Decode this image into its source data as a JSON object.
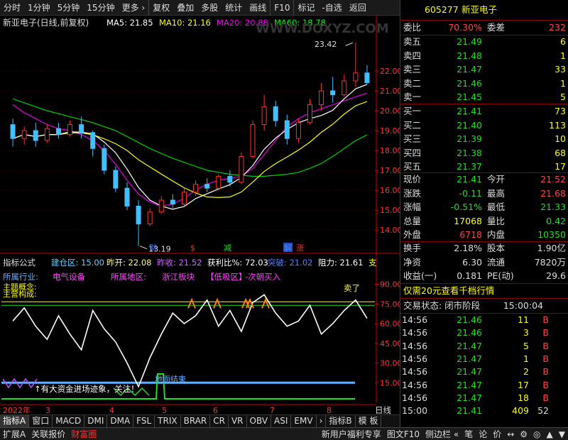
{
  "toolbar": [
    "分时",
    "1分钟",
    "5分钟",
    "15分钟",
    "更多 ›",
    "复权",
    "叠加",
    "多股",
    "统计",
    "画线",
    "F10",
    "标记",
    "-自选",
    "返回"
  ],
  "main": {
    "title": "新亚电子(日线,前复权)",
    "ma": [
      {
        "label": "MA5: 21.85",
        "color": "#ffffff"
      },
      {
        "label": "MA10: 21.16",
        "color": "#ffff00"
      },
      {
        "label": "MA20: 20.88",
        "color": "#ff00ff"
      },
      {
        "label": "MA60: 18.78",
        "color": "#00ff00"
      }
    ],
    "price_ticks": [
      "22.00",
      "21.00",
      "20.00",
      "19.00",
      "18.00",
      "17.00",
      "16.00",
      "15.00",
      "14.00"
    ],
    "high_label": "23.42",
    "low_label": "13.19",
    "markers": [
      "财",
      "$",
      "减",
      "解",
      "涨"
    ],
    "watermark": "WWW.DOXYZ.COM"
  },
  "indicator": {
    "header_label": "指标公式",
    "header_items": [
      {
        "text": "建仓区: 15.00",
        "color": "#5fd3ff"
      },
      {
        "text": "昨开: 22.08",
        "color": "#ffff66"
      },
      {
        "text": "昨收: 21.52",
        "color": "#d066ff"
      },
      {
        "text": "获利比%: 72.03",
        "color": "#ffffff"
      },
      {
        "text": "突破: 21.02",
        "color": "#5080ff"
      },
      {
        "text": "阻力: 21.61",
        "color": "#ffffff"
      },
      {
        "text": "支",
        "color": "#ffff00"
      }
    ],
    "info_row": [
      {
        "text": "所属行业:",
        "color": "#5fb0ff"
      },
      {
        "text": "电气设备",
        "color": "#ff44ff"
      },
      {
        "text": "所属地区:",
        "color": "#ff44ff"
      },
      {
        "text": "浙江板块",
        "color": "#ff44ff"
      },
      {
        "text": "【低吸区】",
        "color": "#ff44ff"
      },
      {
        "text": "-次朝买入",
        "color": "#ff44ff"
      }
    ],
    "left_labels": [
      "主题概念:",
      "主营构成:"
    ],
    "ticks": [
      "90.00",
      "75.00",
      "60.00",
      "45.00",
      "30.00",
      "15.00"
    ],
    "sell_label": "卖了",
    "note": "↑有大资金进场迹象，关注！",
    "end_label": "地面结束"
  },
  "xaxis": {
    "labels": [
      "2022年",
      "3",
      "4",
      "5",
      "6",
      "7",
      "8"
    ],
    "right": "日线"
  },
  "tabs": [
    "指标A",
    "窗口",
    "MACD",
    "DMI",
    "DMA",
    "FSL",
    "TRIX",
    "BRAR",
    "CR",
    "VR",
    "OBV",
    "ASI",
    "EMV",
    "›",
    "指标B",
    "模 板"
  ],
  "bottom": {
    "left": [
      "扩展A",
      "关联报价",
      "财富圈"
    ],
    "right": [
      "新用户福利专享",
      "图文F10",
      "侧边栏 «",
      "笔",
      "论",
      "价",
      "↔",
      "⚙",
      "◎",
      "▲",
      "▼"
    ]
  },
  "quote": {
    "code": "605277",
    "name": "新亚电子",
    "weibi_label": "委比",
    "weibi_value": "70.30%",
    "weicha_label": "委差",
    "weicha_value": "232",
    "sells": [
      {
        "label": "卖五",
        "price": "21.49",
        "vol": "6"
      },
      {
        "label": "卖四",
        "price": "21.48",
        "vol": "1"
      },
      {
        "label": "卖三",
        "price": "21.47",
        "vol": "33"
      },
      {
        "label": "卖二",
        "price": "21.46",
        "vol": "1"
      },
      {
        "label": "卖一",
        "price": "21.45",
        "vol": "5"
      }
    ],
    "buys": [
      {
        "label": "买一",
        "price": "21.41",
        "vol": "73"
      },
      {
        "label": "买二",
        "price": "21.40",
        "vol": "113"
      },
      {
        "label": "买三",
        "price": "21.39",
        "vol": "10"
      },
      {
        "label": "买四",
        "price": "21.38",
        "vol": "68"
      },
      {
        "label": "买五",
        "price": "21.37",
        "vol": "17"
      }
    ],
    "stats": [
      {
        "l1": "现价",
        "v1": "21.41",
        "c1": "#22dd22",
        "l2": "今开",
        "v2": "21.52",
        "c2": "#ff4444"
      },
      {
        "l1": "涨跌",
        "v1": "-0.11",
        "c1": "#22dd22",
        "l2": "最高",
        "v2": "21.68",
        "c2": "#ff4444"
      },
      {
        "l1": "涨幅",
        "v1": "-0.51%",
        "c1": "#22dd22",
        "l2": "最低",
        "v2": "21.33",
        "c2": "#22dd22"
      },
      {
        "l1": "总量",
        "v1": "17068",
        "c1": "#ffff00",
        "l2": "量比",
        "v2": "0.42",
        "c2": "#22dd22"
      },
      {
        "l1": "外盘",
        "v1": "6718",
        "c1": "#ff4444",
        "l2": "内盘",
        "v2": "10350",
        "c2": "#22dd22"
      }
    ],
    "stats2": [
      {
        "l1": "换手",
        "v1": "2.18%",
        "l2": "股本",
        "v2": "1.90亿"
      },
      {
        "l1": "净资",
        "v1": "6.30",
        "l2": "流通",
        "v2": "7820万"
      },
      {
        "l1": "收益(一)",
        "v1": "0.181",
        "l2": "PE(动)",
        "v2": "29.6"
      }
    ],
    "promo": "仅需20元查看千档行情",
    "status_label": "交易状态: 闭市阶段",
    "status_time": "15:00:04",
    "ticks": [
      {
        "t": "14:56",
        "p": "21.46",
        "v": "11",
        "d": "B"
      },
      {
        "t": "14:56",
        "p": "21.46",
        "v": "3",
        "d": "B"
      },
      {
        "t": "14:56",
        "p": "21.47",
        "v": "5",
        "d": "B"
      },
      {
        "t": "14:56",
        "p": "21.47",
        "v": "1",
        "d": "B"
      },
      {
        "t": "14:56",
        "p": "21.47",
        "v": "2",
        "d": "B"
      },
      {
        "t": "14:56",
        "p": "21.47",
        "v": "17",
        "d": "B"
      },
      {
        "t": "14:56",
        "p": "21.47",
        "v": "18",
        "d": "B"
      },
      {
        "t": "15:00",
        "p": "21.41",
        "v": "409",
        "d": "52"
      }
    ]
  },
  "chart_data": {
    "type": "candlestick",
    "title": "新亚电子(日线,前复权)",
    "ylim": [
      13,
      24
    ],
    "yticks": [
      14,
      15,
      16,
      17,
      18,
      19,
      20,
      21,
      22
    ],
    "annotations": {
      "high": 23.42,
      "low": 13.19
    },
    "series": [
      {
        "name": "MA5",
        "color": "#ffffff",
        "last": 21.85
      },
      {
        "name": "MA10",
        "color": "#ffff00",
        "last": 21.16
      },
      {
        "name": "MA20",
        "color": "#ff00ff",
        "last": 20.88
      },
      {
        "name": "MA60",
        "color": "#00ff00",
        "last": 18.78
      }
    ],
    "ma60": [
      20.6,
      20.4,
      20.2,
      20.0,
      19.85,
      19.7,
      19.55,
      19.4,
      19.2,
      19.0,
      18.7,
      18.4,
      18.1,
      17.85,
      17.6,
      17.4,
      17.2,
      17.0,
      16.9,
      16.8,
      16.75,
      16.7,
      16.7,
      16.75,
      16.8,
      16.9,
      17.1,
      17.35,
      17.7,
      18.1,
      18.5,
      18.78
    ],
    "ma20": [
      20.3,
      19.9,
      19.6,
      19.3,
      19.1,
      19.0,
      18.8,
      18.5,
      18.0,
      17.3,
      16.5,
      15.8,
      15.4,
      15.2,
      15.3,
      15.6,
      16.0,
      16.3,
      16.5,
      16.6,
      16.7,
      17.1,
      17.8,
      18.5,
      19.2,
      19.6,
      19.9,
      20.1,
      20.3,
      20.5,
      20.7,
      20.88
    ],
    "candles": [
      [
        19.3,
        19.6,
        18.2,
        18.6
      ],
      [
        18.6,
        19.2,
        18.3,
        19.0
      ],
      [
        19.0,
        19.4,
        18.2,
        18.5
      ],
      [
        18.5,
        19.3,
        18.4,
        19.1
      ],
      [
        19.1,
        19.4,
        18.6,
        18.8
      ],
      [
        18.8,
        19.5,
        18.7,
        19.3
      ],
      [
        19.3,
        19.7,
        18.6,
        18.9
      ],
      [
        18.9,
        19.0,
        17.7,
        18.1
      ],
      [
        18.1,
        18.3,
        16.8,
        17.0
      ],
      [
        17.0,
        17.2,
        15.9,
        16.1
      ],
      [
        16.1,
        16.4,
        15.0,
        15.2
      ],
      [
        15.2,
        15.5,
        13.19,
        14.3
      ],
      [
        14.3,
        15.1,
        14.2,
        14.9
      ],
      [
        14.9,
        15.7,
        14.8,
        15.5
      ],
      [
        15.5,
        15.8,
        15.1,
        15.3
      ],
      [
        15.3,
        16.1,
        15.2,
        15.9
      ],
      [
        15.9,
        16.5,
        15.7,
        16.3
      ],
      [
        16.3,
        16.6,
        15.9,
        16.1
      ],
      [
        16.1,
        16.8,
        16.0,
        16.7
      ],
      [
        16.7,
        17.0,
        16.2,
        16.4
      ],
      [
        16.4,
        17.9,
        16.3,
        17.7
      ],
      [
        17.7,
        19.5,
        17.6,
        19.3
      ],
      [
        19.3,
        20.8,
        19.0,
        20.2
      ],
      [
        20.2,
        20.5,
        19.2,
        19.5
      ],
      [
        19.5,
        19.8,
        18.3,
        18.6
      ],
      [
        18.6,
        19.6,
        18.4,
        19.4
      ],
      [
        19.4,
        20.6,
        19.3,
        20.3
      ],
      [
        20.3,
        21.4,
        20.0,
        21.0
      ],
      [
        21.0,
        21.7,
        20.4,
        20.8
      ],
      [
        20.8,
        21.8,
        20.7,
        21.5
      ],
      [
        21.5,
        23.42,
        21.2,
        21.9
      ],
      [
        21.9,
        22.3,
        21.33,
        21.41
      ]
    ],
    "indicator": {
      "ylim": [
        0,
        100
      ],
      "white": [
        62,
        72,
        58,
        48,
        66,
        52,
        40,
        70,
        56,
        46,
        30,
        12,
        34,
        52,
        68,
        60,
        66,
        78,
        58,
        70,
        54,
        76,
        82,
        68,
        58,
        62,
        74,
        52,
        60,
        70,
        78,
        64
      ],
      "blue_level": 15,
      "yellow_level": 75
    }
  }
}
